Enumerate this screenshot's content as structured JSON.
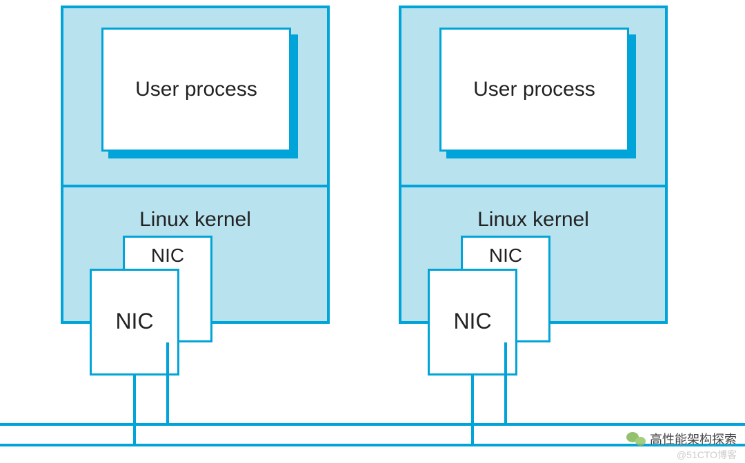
{
  "diagram": {
    "hosts": [
      {
        "user_process": "User process",
        "kernel_label": "Linux kernel",
        "nic_back": "NIC",
        "nic_front": "NIC"
      },
      {
        "user_process": "User process",
        "kernel_label": "Linux kernel",
        "nic_back": "NIC",
        "nic_front": "NIC"
      }
    ]
  },
  "colors": {
    "stroke": "#00a4d8",
    "fill_host": "#b9e2ef",
    "fill_box": "#ffffff"
  },
  "watermark": {
    "main": "高性能架构探索",
    "sub": "@51CTO博客"
  }
}
